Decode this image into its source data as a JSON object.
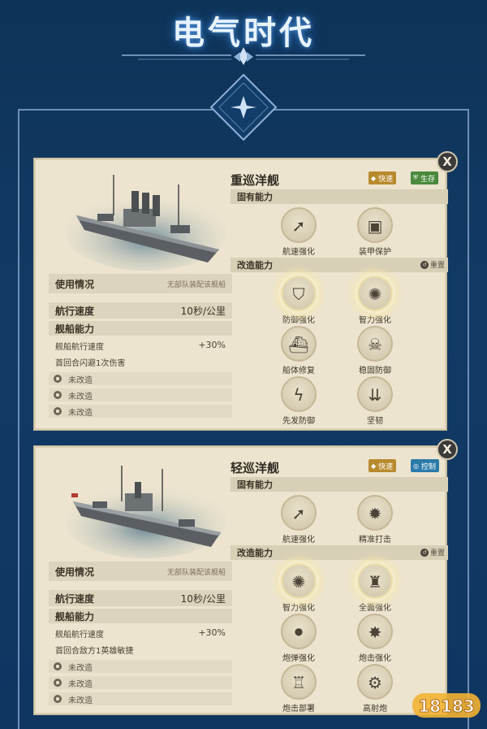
{
  "page": {
    "title": "电气时代"
  },
  "cards": [
    {
      "ship_name": "重巡洋舰",
      "tags": [
        {
          "label": "快速",
          "icon": "speed-icon",
          "color": "#b88a2e"
        },
        {
          "label": "生存",
          "icon": "shield-icon",
          "color": "#4a8a3c"
        }
      ],
      "close_label": "X",
      "usage_label": "使用情况",
      "usage_value": "无部队装配该舰船",
      "speed_label": "航行速度",
      "speed_value": "10秒/公里",
      "ability_title": "舰船能力",
      "stats": [
        {
          "name": "舰船航行速度",
          "value": "+30%"
        },
        {
          "name": "首回合闪避1次伤害",
          "value": ""
        }
      ],
      "locked": [
        "未改造",
        "未改造",
        "未改造"
      ],
      "inherent_title": "固有能力",
      "inherent": [
        {
          "name": "航速强化",
          "icon": "cannon-icon"
        },
        {
          "name": "装甲保护",
          "icon": "armor-icon"
        }
      ],
      "upgrade_title": "改造能力",
      "reset_label": "重置",
      "upgrades": [
        {
          "name": "防御强化",
          "icon": "shield-up-icon",
          "glow": true
        },
        {
          "name": "智力强化",
          "icon": "brain-icon",
          "glow": true
        },
        {
          "name": "船体修复",
          "icon": "ship-repair-icon",
          "glow": false
        },
        {
          "name": "稳固防御",
          "icon": "skull-shield-icon",
          "glow": false
        },
        {
          "name": "先发防御",
          "icon": "lightning-shield-icon",
          "glow": false
        },
        {
          "name": "坚韧",
          "icon": "arrows-down-icon",
          "glow": false
        }
      ]
    },
    {
      "ship_name": "轻巡洋舰",
      "tags": [
        {
          "label": "快速",
          "icon": "speed-icon",
          "color": "#b88a2e"
        },
        {
          "label": "控制",
          "icon": "target-icon",
          "color": "#2a7aa8"
        }
      ],
      "close_label": "X",
      "usage_label": "使用情况",
      "usage_value": "无部队装配该舰船",
      "speed_label": "航行速度",
      "speed_value": "10秒/公里",
      "ability_title": "舰船能力",
      "stats": [
        {
          "name": "舰船航行速度",
          "value": "+30%"
        },
        {
          "name": "首回合敌方1英雄敏捷",
          "value": ""
        }
      ],
      "locked": [
        "未改造",
        "未改造",
        "未改造"
      ],
      "inherent_title": "固有能力",
      "inherent": [
        {
          "name": "航速强化",
          "icon": "cannon-icon"
        },
        {
          "name": "精准打击",
          "icon": "precision-strike-icon"
        }
      ],
      "upgrade_title": "改造能力",
      "reset_label": "重置",
      "upgrades": [
        {
          "name": "智力强化",
          "icon": "brain-icon",
          "glow": true
        },
        {
          "name": "全面强化",
          "icon": "fortress-icon",
          "glow": true
        },
        {
          "name": "炮弹强化",
          "icon": "shell-icon",
          "glow": false
        },
        {
          "name": "炮击强化",
          "icon": "barrage-icon",
          "glow": false
        },
        {
          "name": "炮击部署",
          "icon": "deploy-icon",
          "glow": false
        },
        {
          "name": "高射炮",
          "icon": "aa-gun-icon",
          "glow": false
        }
      ]
    }
  ],
  "watermark": {
    "text": "18183"
  }
}
